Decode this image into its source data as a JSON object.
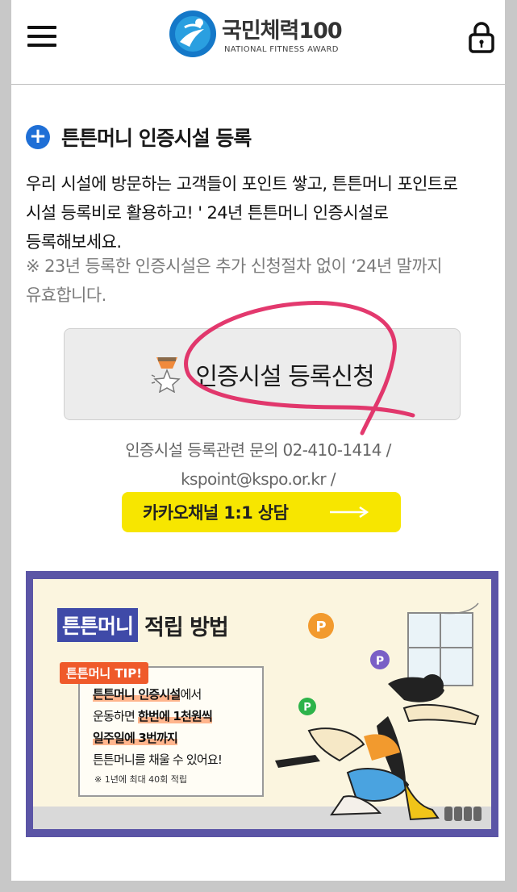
{
  "header": {
    "logo_title": "국민체력100",
    "logo_subtitle": "NATIONAL FITNESS AWARD",
    "menu_icon": "hamburger-menu-icon",
    "lock_icon": "lock-icon"
  },
  "section": {
    "title": "튼튼머니 인증시설 등록",
    "description_lines": [
      "우리 시설에 방문하는 고객들이 포인트 쌓고, 튼튼머니 포인트로",
      "시설 등록비로 활용하고! ' 24년 튼튼머니 인증시설로",
      "등록해보세요."
    ],
    "note_lines": [
      "※ 23년 등록한 인증시설은 추가 신청절차 없이 ‘24년 말까지",
      "유효합니다."
    ]
  },
  "register_button": {
    "label": "인증시설 등록신청",
    "icon": "medal-icon"
  },
  "contact": {
    "line1": "인증시설 등록관련 문의 02-410-1414 /",
    "line2": "kspoint@kspo.or.kr /"
  },
  "kakao_button": {
    "label": "카카오채널 1:1 상담",
    "icon": "arrow-right-icon"
  },
  "banner": {
    "title_chip": "튼튼머니",
    "title_rest": "적립 방법",
    "tip_label": "튼튼머니 TIP!",
    "tip_line1_hl": "튼튼머니 인증시설",
    "tip_line1_rest": "에서",
    "tip_line2_pre": "운동하면 ",
    "tip_line2_hl": "한번에 1천원씩",
    "tip_line3_hl": "일주일에 3번까지",
    "tip_line4": "튼튼머니를 채울 수 있어요!",
    "tip_note": "※ 1년에 최대 40회 적립",
    "coin_letter": "P"
  },
  "colors": {
    "accent_blue": "#1f6fd6",
    "kakao_yellow": "#f7e600",
    "banner_frame": "#5b55a6",
    "tip_orange": "#ef5a2a",
    "scribble_pink": "#e0245e"
  }
}
